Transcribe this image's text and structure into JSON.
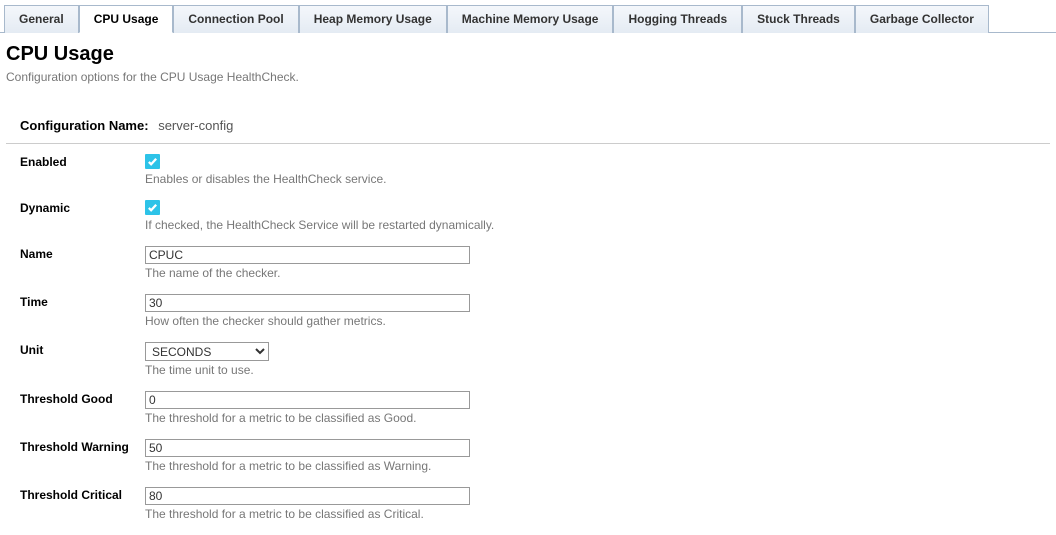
{
  "tabs": [
    {
      "label": "General",
      "active": false
    },
    {
      "label": "CPU Usage",
      "active": true
    },
    {
      "label": "Connection Pool",
      "active": false
    },
    {
      "label": "Heap Memory Usage",
      "active": false
    },
    {
      "label": "Machine Memory Usage",
      "active": false
    },
    {
      "label": "Hogging Threads",
      "active": false
    },
    {
      "label": "Stuck Threads",
      "active": false
    },
    {
      "label": "Garbage Collector",
      "active": false
    }
  ],
  "header": {
    "title": "CPU Usage",
    "subtitle": "Configuration options for the CPU Usage HealthCheck."
  },
  "config": {
    "name_label": "Configuration Name:",
    "name_value": "server-config"
  },
  "fields": {
    "enabled": {
      "label": "Enabled",
      "checked": true,
      "help": "Enables or disables the HealthCheck service."
    },
    "dynamic": {
      "label": "Dynamic",
      "checked": true,
      "help": "If checked, the HealthCheck Service will be restarted dynamically."
    },
    "name": {
      "label": "Name",
      "value": "CPUC",
      "help": "The name of the checker."
    },
    "time": {
      "label": "Time",
      "value": "30",
      "help": "How often the checker should gather metrics."
    },
    "unit": {
      "label": "Unit",
      "value": "SECONDS",
      "help": "The time unit to use."
    },
    "threshold_good": {
      "label": "Threshold Good",
      "value": "0",
      "help": "The threshold for a metric to be classified as Good."
    },
    "threshold_warning": {
      "label": "Threshold Warning",
      "value": "50",
      "help": "The threshold for a metric to be classified as Warning."
    },
    "threshold_critical": {
      "label": "Threshold Critical",
      "value": "80",
      "help": "The threshold for a metric to be classified as Critical."
    }
  }
}
